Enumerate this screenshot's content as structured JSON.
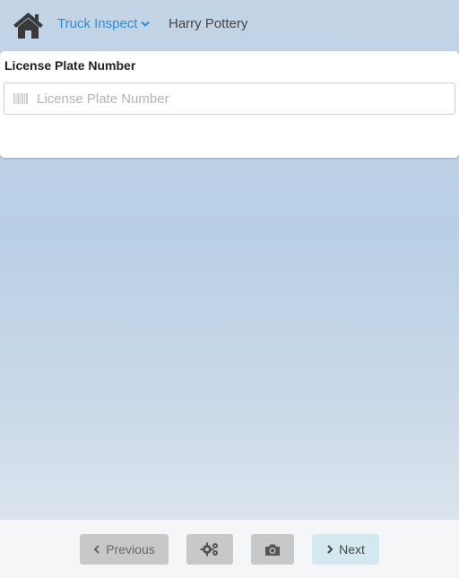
{
  "header": {
    "app_name": "Truck Inspect",
    "user_name": "Harry Pottery"
  },
  "form": {
    "field_label": "License Plate Number",
    "field_placeholder": "License Plate Number",
    "field_value": ""
  },
  "footer": {
    "previous_label": "Previous",
    "next_label": "Next",
    "settings_icon": "gears-icon",
    "camera_icon": "camera-icon"
  },
  "colors": {
    "accent": "#2a8ed8",
    "next_button": "#d3e9ef",
    "disabled_button": "#c8c8c8"
  }
}
